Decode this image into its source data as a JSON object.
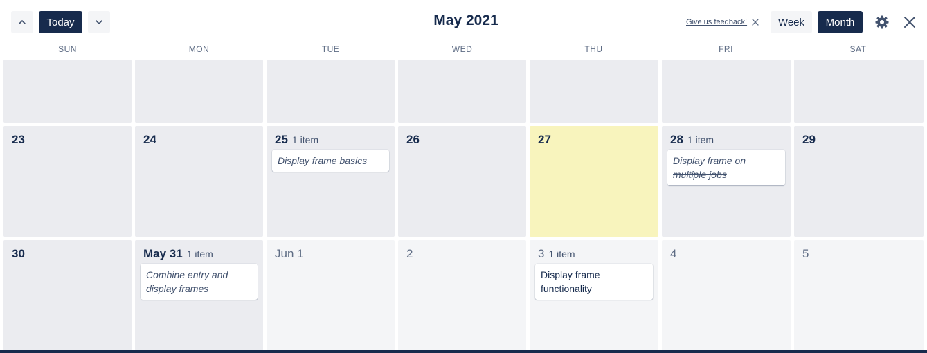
{
  "toolbar": {
    "today_label": "Today",
    "title": "May 2021",
    "feedback_label": "Give us feedback!",
    "week_label": "Week",
    "month_label": "Month"
  },
  "weekdays": [
    "SUN",
    "MON",
    "TUE",
    "WED",
    "THU",
    "FRI",
    "SAT"
  ],
  "rows": [
    {
      "days": [
        {
          "label": "",
          "count": "",
          "style": "past"
        },
        {
          "label": "",
          "count": "",
          "style": "past"
        },
        {
          "label": "",
          "count": "",
          "style": "past"
        },
        {
          "label": "",
          "count": "",
          "style": "past"
        },
        {
          "label": "",
          "count": "",
          "style": "past"
        },
        {
          "label": "",
          "count": "",
          "style": "past"
        },
        {
          "label": "",
          "count": "",
          "style": "past"
        }
      ]
    },
    {
      "days": [
        {
          "label": "23",
          "count": "",
          "style": "past"
        },
        {
          "label": "24",
          "count": "",
          "style": "past"
        },
        {
          "label": "25",
          "count": "1 item",
          "style": "past",
          "card": {
            "text": "Display frame basics",
            "done": true
          }
        },
        {
          "label": "26",
          "count": "",
          "style": "past"
        },
        {
          "label": "27",
          "count": "",
          "style": "today"
        },
        {
          "label": "28",
          "count": "1 item",
          "style": "past",
          "card": {
            "text": "Display frame on multiple jobs",
            "done": true
          }
        },
        {
          "label": "29",
          "count": "",
          "style": "past"
        }
      ]
    },
    {
      "days": [
        {
          "label": "30",
          "count": "",
          "style": "past"
        },
        {
          "label": "May 31",
          "count": "1 item",
          "style": "past",
          "card": {
            "text": "Combine entry and display frames",
            "done": true
          }
        },
        {
          "label": "Jun 1",
          "count": "",
          "style": "future"
        },
        {
          "label": "2",
          "count": "",
          "style": "future"
        },
        {
          "label": "3",
          "count": "1 item",
          "style": "future",
          "card": {
            "text": "Display frame functionality",
            "done": false
          }
        },
        {
          "label": "4",
          "count": "",
          "style": "future"
        },
        {
          "label": "5",
          "count": "",
          "style": "future"
        }
      ]
    }
  ],
  "colors": {
    "primary": "#172b4d",
    "past_cell": "#ebecf0",
    "future_cell": "#f4f5f7",
    "today_cell": "#f8f4bd"
  },
  "icons": [
    "chevron-up-icon",
    "chevron-down-icon",
    "close-icon",
    "gear-icon"
  ]
}
